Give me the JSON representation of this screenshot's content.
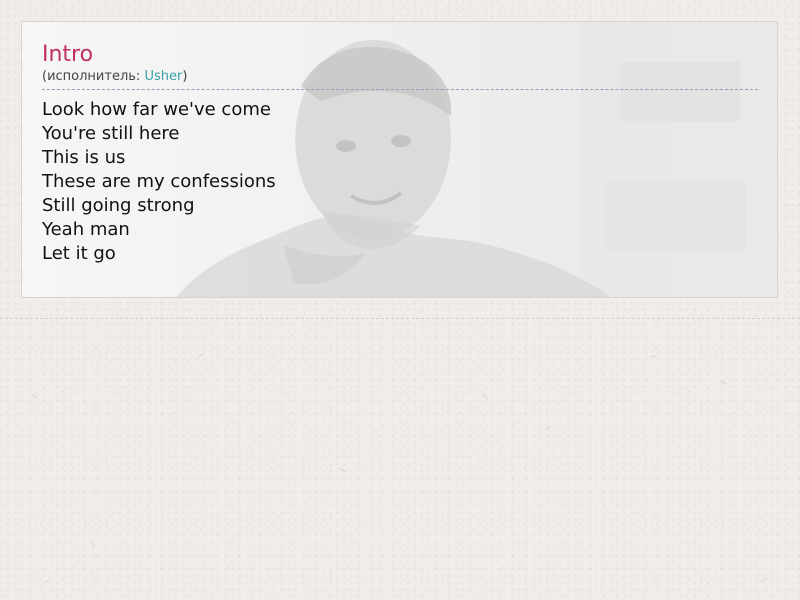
{
  "song": {
    "title": "Intro",
    "performer_prefix": "(исполнитель: ",
    "performer_name": "Usher",
    "performer_suffix": ")"
  },
  "lyrics": [
    "Look how far we've come",
    "You're still here",
    "This is us",
    "These are my confessions",
    "Still going strong",
    "Yeah man",
    "Let it go"
  ],
  "colors": {
    "title": "#c0305c",
    "performer_link": "#3aa3a8",
    "text": "#111111",
    "page_background": "#f1eeea"
  }
}
